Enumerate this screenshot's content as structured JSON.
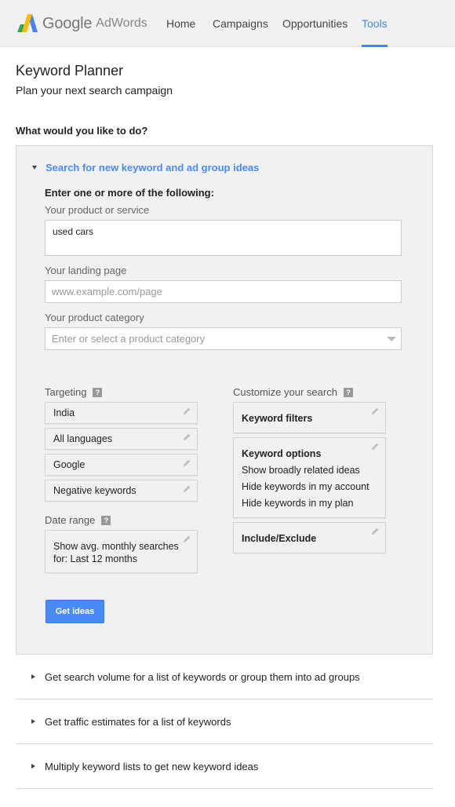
{
  "header": {
    "logo_google": "Google",
    "logo_adwords": "AdWords",
    "nav": [
      {
        "label": "Home",
        "active": false
      },
      {
        "label": "Campaigns",
        "active": false
      },
      {
        "label": "Opportunities",
        "active": false
      },
      {
        "label": "Tools",
        "active": true
      }
    ],
    "accent_color": "#4285f4"
  },
  "page": {
    "title": "Keyword Planner",
    "subtitle": "Plan your next search campaign",
    "question": "What would you like to do?"
  },
  "search_section": {
    "heading": "Search for new keyword and ad group ideas",
    "enter_label": "Enter one or more of the following:",
    "product_label": "Your product or service",
    "product_value": "used cars",
    "landing_label": "Your landing page",
    "landing_placeholder": "www.example.com/page",
    "category_label": "Your product category",
    "category_placeholder": "Enter or select a product category",
    "targeting_label": "Targeting",
    "targeting_items": [
      "India",
      "All languages",
      "Google",
      "Negative keywords"
    ],
    "date_range_label": "Date range",
    "date_range_line1": "Show avg. monthly searches",
    "date_range_line2": "for: Last 12 months",
    "customize_label": "Customize your search",
    "keyword_filters": "Keyword filters",
    "keyword_options": {
      "title": "Keyword options",
      "lines": [
        "Show broadly related ideas",
        "Hide keywords in my account",
        "Hide keywords in my plan"
      ]
    },
    "include_exclude": "Include/Exclude",
    "help_glyph": "?",
    "get_ideas_button": "Get ideas",
    "button_color": "#4a8af4"
  },
  "other_options": [
    "Get search volume for a list of keywords or group them into ad groups",
    "Get traffic estimates for a list of keywords",
    "Multiply keyword lists to get new keyword ideas"
  ]
}
